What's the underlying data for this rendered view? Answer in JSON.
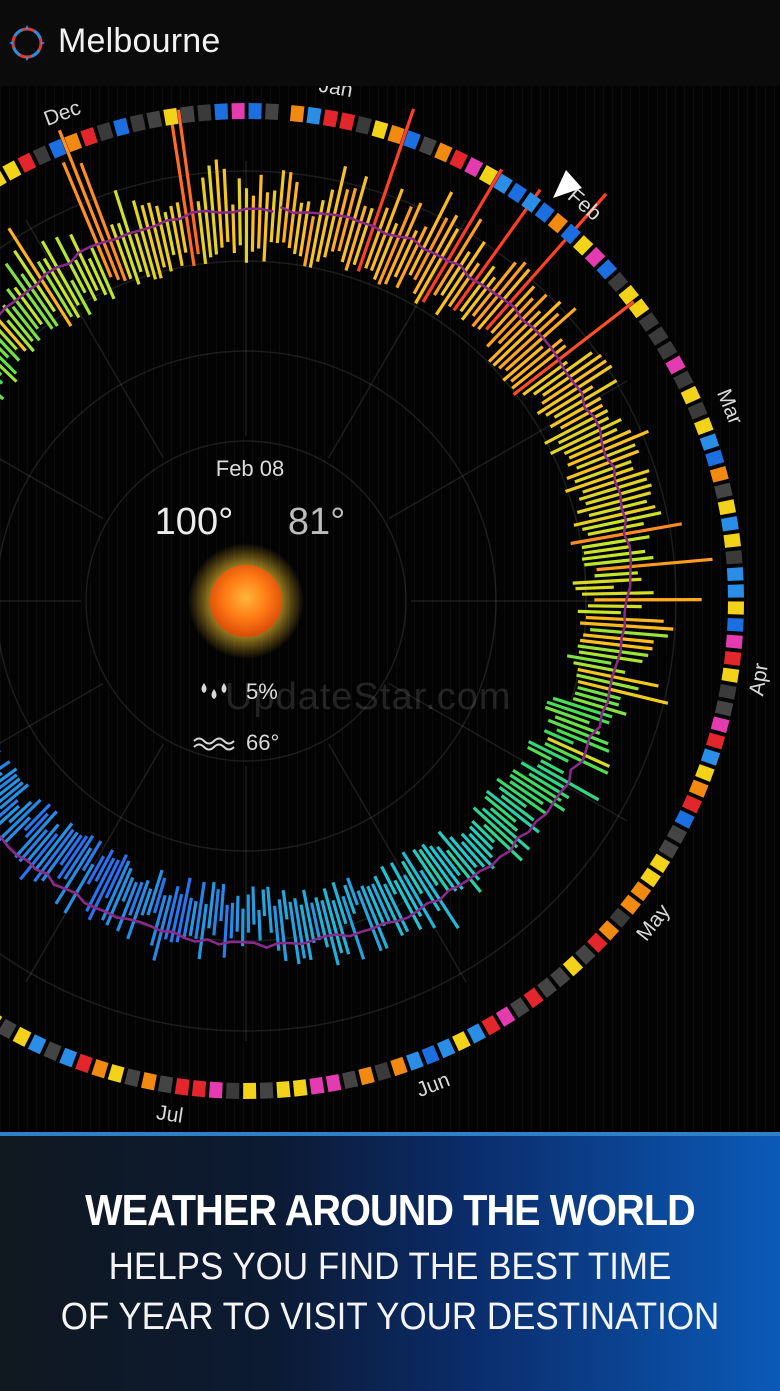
{
  "header": {
    "city": "Melbourne",
    "logo_icon": "sun-ring-logo-icon"
  },
  "wheel": {
    "months": [
      "Jan",
      "Feb",
      "Mar",
      "Apr",
      "May",
      "Jun",
      "Jul",
      "Dec"
    ],
    "selected_date": "Feb 08",
    "high_temp": "100°",
    "low_temp": "81°",
    "weather_icon": "sun-icon",
    "precipitation": "5%",
    "precipitation_icon": "raindrops-icon",
    "water_temp": "66°",
    "water_temp_icon": "waves-icon",
    "marker_icon": "triangle-pointer-icon"
  },
  "watermark": "UpdateStar.com",
  "footer": {
    "headline": "WEATHER AROUND THE WORLD",
    "line2": "HELPS YOU FIND THE BEST TIME",
    "line3": "OF YEAR TO VISIT YOUR DESTINATION"
  },
  "colors": {
    "background": "#000000",
    "footer_blue": "#0b5ab8",
    "average_line": "#8a2a8c",
    "sun": "#ff8c1a"
  }
}
